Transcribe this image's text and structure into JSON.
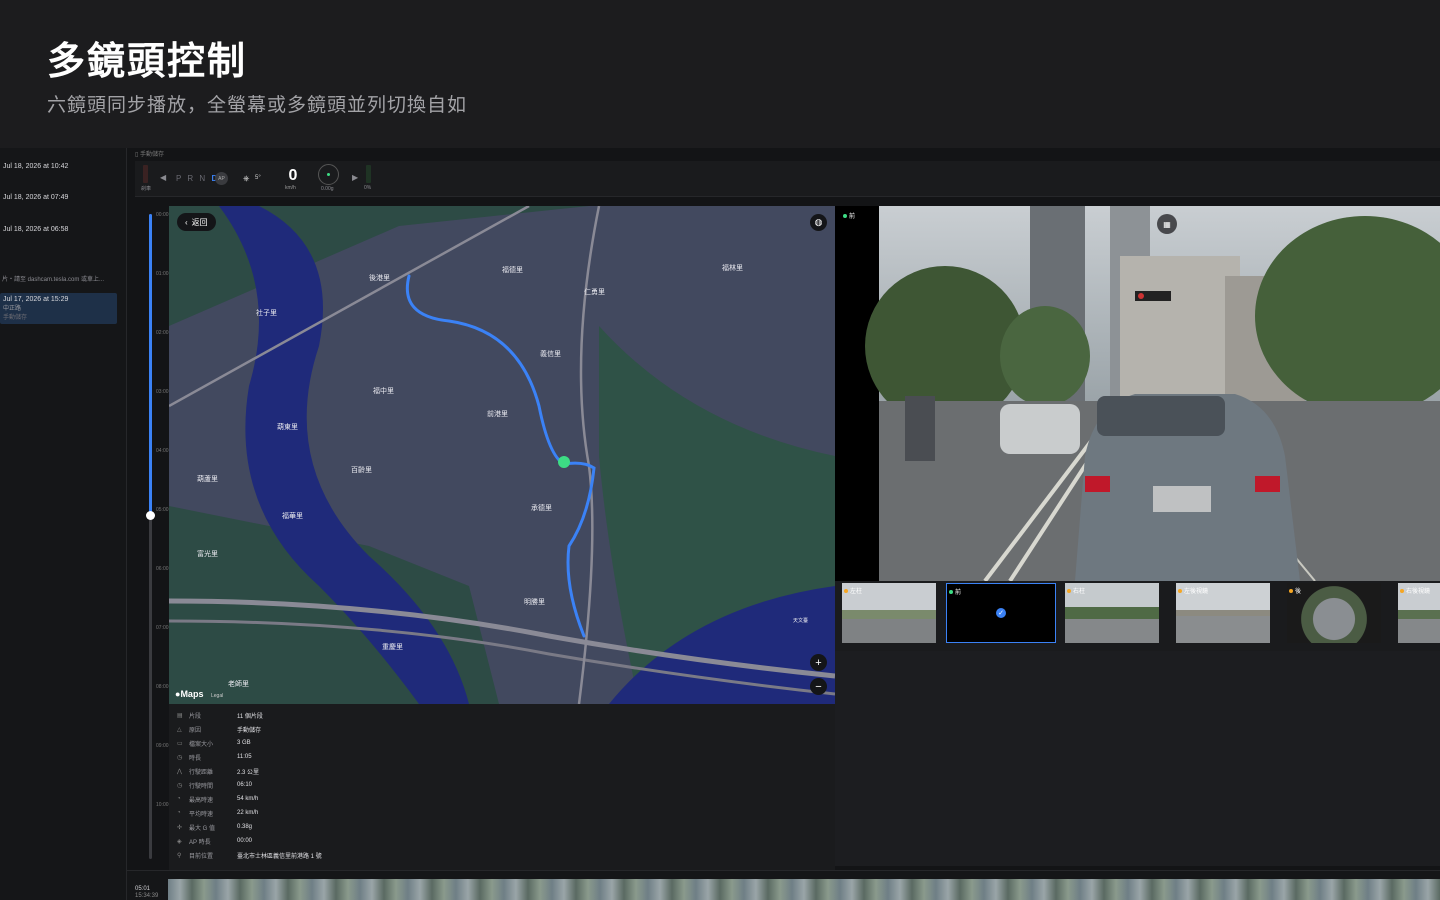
{
  "hero": {
    "title": "多鏡頭控制",
    "subtitle": "六鏡頭同步播放，全螢幕或多鏡頭並列切換自如"
  },
  "sidebar": {
    "clips": [
      {
        "date": "Jul 18, 2026 at 10:42"
      },
      {
        "date": "Jul 18, 2026 at 07:49"
      },
      {
        "date": "Jul 18, 2026 at 06:58"
      }
    ],
    "note": "片・請至 dashcam.tesla.com 或車上...",
    "selected_clip": {
      "date": "Jul 17, 2026 at 15:29",
      "location": "中正路",
      "reason": "手動儲存"
    }
  },
  "topbar": {
    "crumb": "手動儲存",
    "brake_label": "剎車",
    "gear_left": "P R N",
    "gear_active": "D",
    "ap_badge": "AP",
    "steer_value": "5°",
    "speed": "0",
    "speed_unit": "km/h",
    "g_value": "0.00g",
    "throttle": "0%"
  },
  "timeline": {
    "ticks": [
      "00:00",
      "01:00",
      "02:00",
      "03:00",
      "04:00",
      "05:00",
      "06:00",
      "07:00",
      "08:00",
      "09:00",
      "10:00"
    ]
  },
  "map": {
    "back_label": "返回",
    "maps_brand": "Maps",
    "legal": "Legal",
    "labels": [
      {
        "text": "後港里"
      },
      {
        "text": "福德里"
      },
      {
        "text": "仁勇里"
      },
      {
        "text": "福林里"
      },
      {
        "text": "社子里"
      },
      {
        "text": "義信里"
      },
      {
        "text": "福中里"
      },
      {
        "text": "前港里"
      },
      {
        "text": "葫東里"
      },
      {
        "text": "百齡里"
      },
      {
        "text": "葫蘆里"
      },
      {
        "text": "福華里"
      },
      {
        "text": "承德里"
      },
      {
        "text": "富光里"
      },
      {
        "text": "明勝里"
      },
      {
        "text": "重慶里"
      },
      {
        "text": "老師里"
      },
      {
        "text": "天文臺"
      }
    ]
  },
  "info": {
    "rows": [
      {
        "icon": "film-icon",
        "glyph": "▤",
        "key": "片段",
        "value": "11 個片段"
      },
      {
        "icon": "warning-icon",
        "glyph": "△",
        "key": "原因",
        "value": "手動儲存"
      },
      {
        "icon": "disk-icon",
        "glyph": "▭",
        "key": "檔案大小",
        "value": "3 GB"
      },
      {
        "icon": "clock-icon",
        "glyph": "◷",
        "key": "時長",
        "value": "11:05"
      },
      {
        "icon": "distance-icon",
        "glyph": "⋀",
        "key": "行駛距離",
        "value": "2.3 公里"
      },
      {
        "icon": "timer-icon",
        "glyph": "◷",
        "key": "行駛時間",
        "value": "06:10"
      },
      {
        "icon": "speedometer-icon",
        "glyph": "◔",
        "key": "最高時速",
        "value": "54 km/h"
      },
      {
        "icon": "speedometer-icon",
        "glyph": "◔",
        "key": "平均時速",
        "value": "22 km/h"
      },
      {
        "icon": "gforce-icon",
        "glyph": "✢",
        "key": "最大 G 值",
        "value": "0.38g"
      },
      {
        "icon": "autopilot-icon",
        "glyph": "◈",
        "key": "AP 時長",
        "value": "00:00"
      },
      {
        "icon": "location-icon",
        "glyph": "⚲",
        "key": "目前位置",
        "value": "臺北市士林區義信里前港路 1 號"
      }
    ]
  },
  "video": {
    "camera_label": "前"
  },
  "thumbnails": [
    {
      "label": "左柱",
      "selected": false
    },
    {
      "label": "前",
      "selected": true
    },
    {
      "label": "右柱",
      "selected": false
    },
    {
      "label": "左後視鏡",
      "selected": false
    },
    {
      "label": "後",
      "selected": false
    },
    {
      "label": "右後視鏡",
      "selected": false
    }
  ],
  "bottom": {
    "time": "05:01",
    "clock": "15:34:39"
  },
  "colors": {
    "accent": "#3b82f6",
    "route": "#3b82f6",
    "live_dot": "#3ddc84"
  }
}
